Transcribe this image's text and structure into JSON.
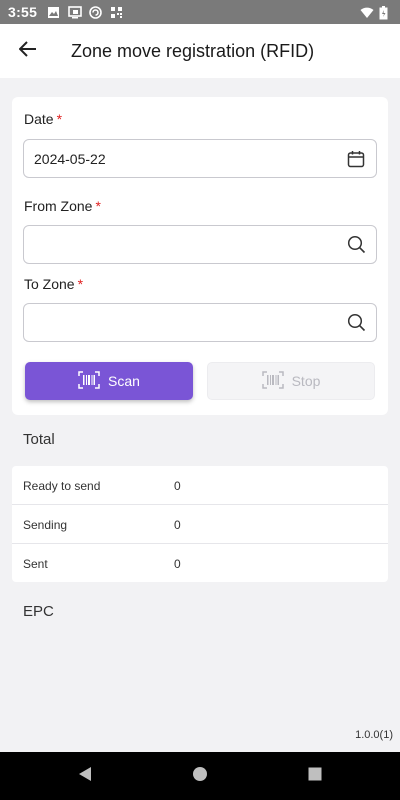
{
  "status_bar": {
    "time": "3:55"
  },
  "app_bar": {
    "title": "Zone move registration (RFID)"
  },
  "form": {
    "date": {
      "label": "Date",
      "required_mark": "*",
      "value": "2024-05-22"
    },
    "from_zone": {
      "label": "From Zone",
      "required_mark": "*",
      "value": ""
    },
    "to_zone": {
      "label": "To Zone",
      "required_mark": "*",
      "value": ""
    },
    "scan_button": "Scan",
    "stop_button": "Stop"
  },
  "total": {
    "title": "Total",
    "rows": [
      {
        "label": "Ready to send",
        "value": "0"
      },
      {
        "label": "Sending",
        "value": "0"
      },
      {
        "label": "Sent",
        "value": "0"
      }
    ]
  },
  "epc": {
    "title": "EPC"
  },
  "version": "1.0.0(1)",
  "colors": {
    "accent": "#7a55d6",
    "required": "#e02020",
    "background": "#f2f2f4"
  },
  "icons": {
    "back": "arrow-left-icon",
    "calendar": "calendar-icon",
    "search": "search-icon",
    "barcode": "barcode-icon"
  }
}
